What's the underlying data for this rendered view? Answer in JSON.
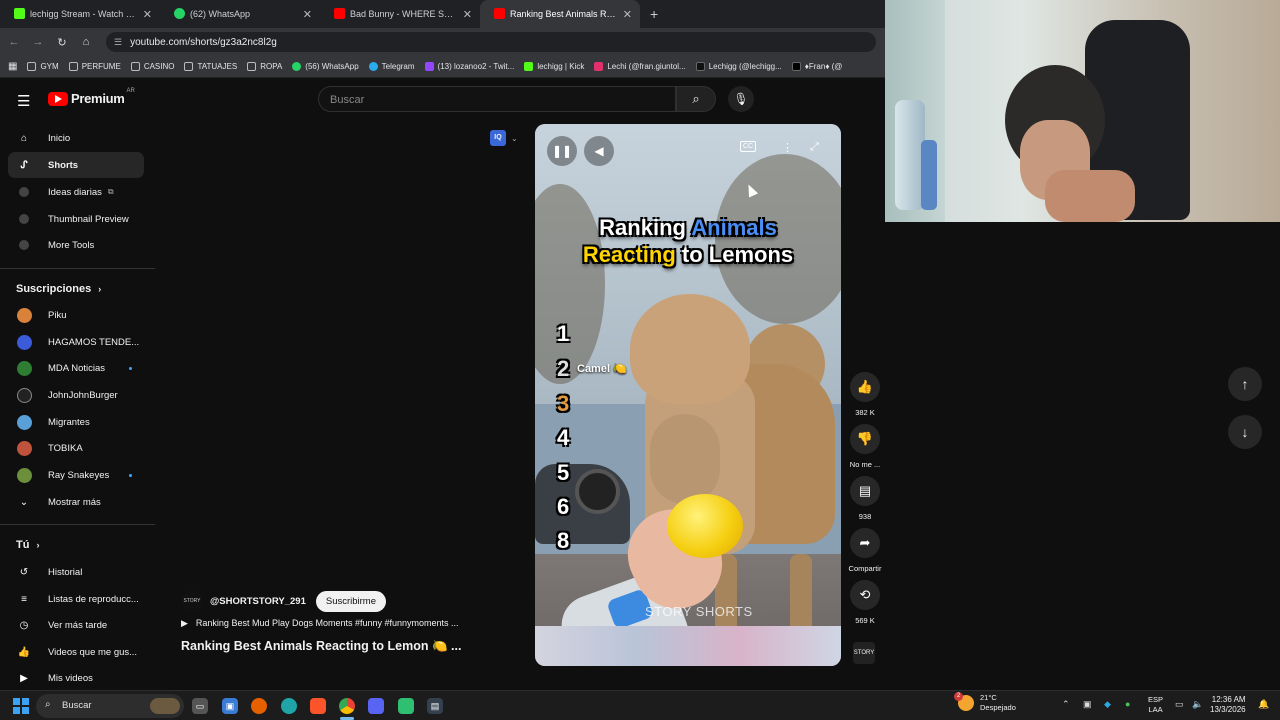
{
  "browser": {
    "tabs": [
      {
        "label": "lechigg Stream - Watch Live on",
        "color": "#53fc18"
      },
      {
        "label": "(62) WhatsApp",
        "color": "#25d366"
      },
      {
        "label": "Bad Bunny - WHERE SHE GOES",
        "color": "#ff0000"
      },
      {
        "label": "Ranking Best Animals Reacting",
        "color": "#ff0000"
      }
    ],
    "url": "youtube.com/shorts/gz3a2nc8l2g",
    "bookmarks": [
      {
        "label": "GYM",
        "icon": "folder-icon",
        "color": "#9aa0a6"
      },
      {
        "label": "PERFUME",
        "icon": "folder-icon",
        "color": "#9aa0a6"
      },
      {
        "label": "CASINO",
        "icon": "folder-icon",
        "color": "#9aa0a6"
      },
      {
        "label": "TATUAJES",
        "icon": "folder-icon",
        "color": "#9aa0a6"
      },
      {
        "label": "ROPA",
        "icon": "folder-icon",
        "color": "#9aa0a6"
      },
      {
        "label": "(56) WhatsApp",
        "icon": "whatsapp-icon",
        "color": "#25d366"
      },
      {
        "label": "Telegram",
        "icon": "telegram-icon",
        "color": "#2aabee"
      },
      {
        "label": "(13) lozanoo2 - Twit...",
        "icon": "twitch-icon",
        "color": "#9146ff"
      },
      {
        "label": "lechigg | Kick",
        "icon": "kick-icon",
        "color": "#53fc18"
      },
      {
        "label": "Lechi (@fran.giuntol...",
        "icon": "instagram-icon",
        "color": "#e1306c"
      },
      {
        "label": "Lechigg (@lechigg...",
        "icon": "tiktok-icon",
        "color": "#222222"
      },
      {
        "label": "♦Fran♦ (@",
        "icon": "x-icon",
        "color": "#000000"
      }
    ]
  },
  "header": {
    "logo_text": "Premium",
    "country_code": "AR",
    "search_placeholder": "Buscar"
  },
  "sidebar": {
    "main": [
      {
        "label": "Inicio",
        "icon": "home-icon"
      },
      {
        "label": "Shorts",
        "icon": "shorts-icon"
      },
      {
        "label": "Ideas diarias",
        "icon": "extension-icon"
      },
      {
        "label": "Thumbnail Preview",
        "icon": "extension-icon"
      },
      {
        "label": "More Tools",
        "icon": "extension-icon"
      }
    ],
    "subs_title": "Suscripciones",
    "subscriptions": [
      {
        "label": "Piku",
        "color": "#d9823b",
        "dot": false
      },
      {
        "label": "HAGAMOS TENDE...",
        "color": "#3b5bd9",
        "dot": false
      },
      {
        "label": "MDA Noticias",
        "color": "#2e7d32",
        "dot": true
      },
      {
        "label": "JohnJohnBurger",
        "color": "#222222",
        "dot": false
      },
      {
        "label": "Migrantes",
        "color": "#5aa0d8",
        "dot": false
      },
      {
        "label": "TOBIKA",
        "color": "#c0533b",
        "dot": false
      },
      {
        "label": "Ray Snakeyes",
        "color": "#6b8f3a",
        "dot": true
      }
    ],
    "show_more": "Mostrar más",
    "you_title": "Tú",
    "you": [
      {
        "label": "Historial",
        "icon": "history-icon"
      },
      {
        "label": "Listas de reproducc...",
        "icon": "playlist-icon"
      },
      {
        "label": "Ver más tarde",
        "icon": "clock-icon"
      },
      {
        "label": "Videos que me gus...",
        "icon": "thumbs-up-icon"
      },
      {
        "label": "Mis videos",
        "icon": "video-icon"
      }
    ]
  },
  "extension": {
    "badge": "IQ"
  },
  "short": {
    "title_line1_a": "Ranking",
    "title_line1_b": "Animals",
    "title_line2_a": "Reacting",
    "title_line2_b": "to Lemons",
    "ranks": [
      "1",
      "2",
      "3",
      "4",
      "5",
      "6",
      "8"
    ],
    "rank2_label": "Camel 🍋",
    "watermark": "STORY SHORTS",
    "channel_avatar_text": "STORY",
    "channel": "@SHORTSTORY_291",
    "subscribe": "Suscribirme",
    "description": "Ranking Best Mud Play Dogs Moments #funny #funnymoments ...",
    "title": "Ranking Best Animals Reacting to Lemon 🍋 ..."
  },
  "actions": {
    "like_count": "382 K",
    "dislike_label": "No me ...",
    "comments": "938",
    "share": "Compartir",
    "remix": "569 K"
  },
  "taskbar": {
    "search": "Buscar",
    "temp": "21°C",
    "condition": "Despejado",
    "weather_badge": "2",
    "lang1": "ESP",
    "lang2": "LAA",
    "time": "12:36 AM",
    "date": "13/3/2026"
  }
}
